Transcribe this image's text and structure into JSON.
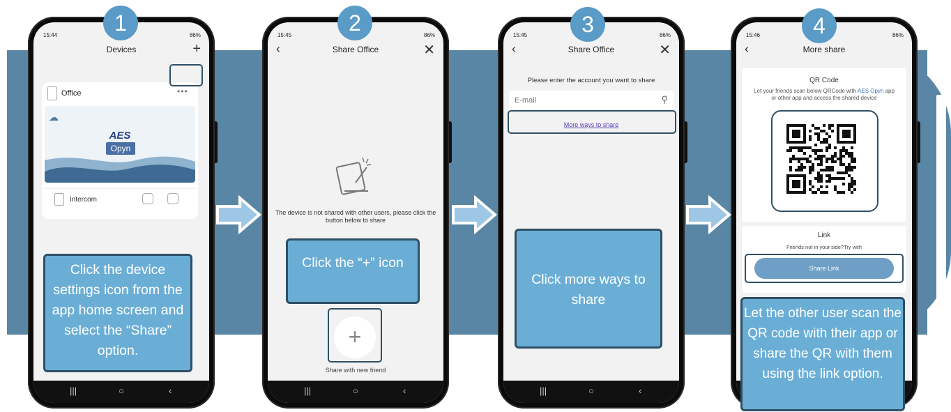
{
  "steps": [
    {
      "number": "1",
      "status_time": "15:44",
      "status_right": "86%",
      "header_title": "Devices",
      "header_right": "+",
      "office_label": "Office",
      "more_dots": "•••",
      "logo_top": "AES",
      "logo_bottom": "Opyn",
      "intercom_label": "Intercom",
      "callout": "Click the device settings icon from the app home screen and select the “Share” option.",
      "nav": [
        "|||",
        "○",
        "‹"
      ]
    },
    {
      "number": "2",
      "status_time": "15:45",
      "status_right": "86%",
      "header_title": "Share Office",
      "header_left": "‹",
      "header_right": "✕",
      "message": "The device is not shared with other users, please click the button below to share",
      "callout": "Click the “+” icon",
      "plus": "+",
      "share_new_friend": "Share with new friend",
      "nav": [
        "|||",
        "○",
        "‹"
      ]
    },
    {
      "number": "3",
      "status_time": "15:45",
      "status_right": "86%",
      "header_title": "Share Office",
      "header_left": "‹",
      "header_right": "✕",
      "prompt": "Please enter the account you want to share",
      "email_placeholder": "E-mail",
      "more_ways": "More ways to share",
      "callout": "Click more ways to share",
      "nav": [
        "|||",
        "○",
        "‹"
      ]
    },
    {
      "number": "4",
      "status_time": "15:46",
      "status_right": "86%",
      "header_title": "More share",
      "header_left": "‹",
      "qr_title": "QR Code",
      "qr_desc_1": "Let your friends scan below QRCode with ",
      "qr_desc_brand": "AES Opyn",
      "qr_desc_2": " app or other app and access the shared device",
      "link_title": "Link",
      "link_desc": "Friends not in your side?Try with",
      "share_link": "Share Link",
      "callout": "Let the other user scan the QR code with their app or share the QR with them using the link option.",
      "nav": [
        "|||",
        "○",
        "‹"
      ]
    }
  ],
  "colors": {
    "band": "#5a86a5",
    "badge": "#5a9bc8",
    "callout": "#6aaed6",
    "callout_border": "#2e4f66"
  }
}
